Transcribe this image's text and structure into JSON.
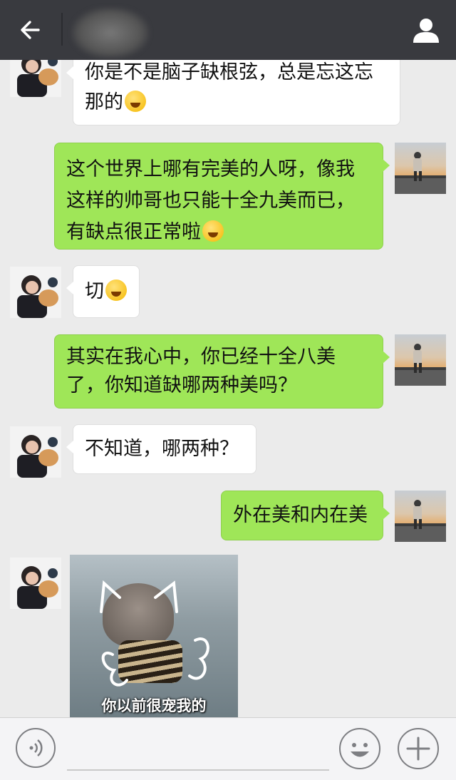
{
  "header": {
    "back_icon": "arrow-left-icon",
    "profile_icon": "person-icon",
    "colors": {
      "bar": "#393a3f",
      "icon": "#ffffff"
    }
  },
  "messages": [
    {
      "side": "left",
      "text": "你是不是脑子缺根弦，总是忘这忘",
      "text2": "那的",
      "emoji": "crying-laughing-emoji"
    },
    {
      "side": "right",
      "line1": "这个世界上哪有完美的人呀，像我",
      "line2": "这样的帅哥也只能十全九美而已，",
      "line3": "有缺点很正常啦",
      "emoji": "tongue-wink-emoji"
    },
    {
      "side": "left",
      "text": "切",
      "emoji": "surprised-emoji"
    },
    {
      "side": "right",
      "line1": "其实在我心中，你已经十全八美",
      "line2": "了，你知道缺哪两种美吗？"
    },
    {
      "side": "left",
      "text": "不知道，哪两种？"
    },
    {
      "side": "right",
      "text": "外在美和内在美"
    },
    {
      "side": "left",
      "sticker_caption": "你以前很宠我的"
    }
  ],
  "colors": {
    "chat_bg": "#ebebeb",
    "bubble_left": "#ffffff",
    "bubble_right": "#9fe658"
  },
  "bottom": {
    "voice_icon": "voice-icon",
    "emoji_icon": "smiley-icon",
    "plus_icon": "plus-icon"
  }
}
